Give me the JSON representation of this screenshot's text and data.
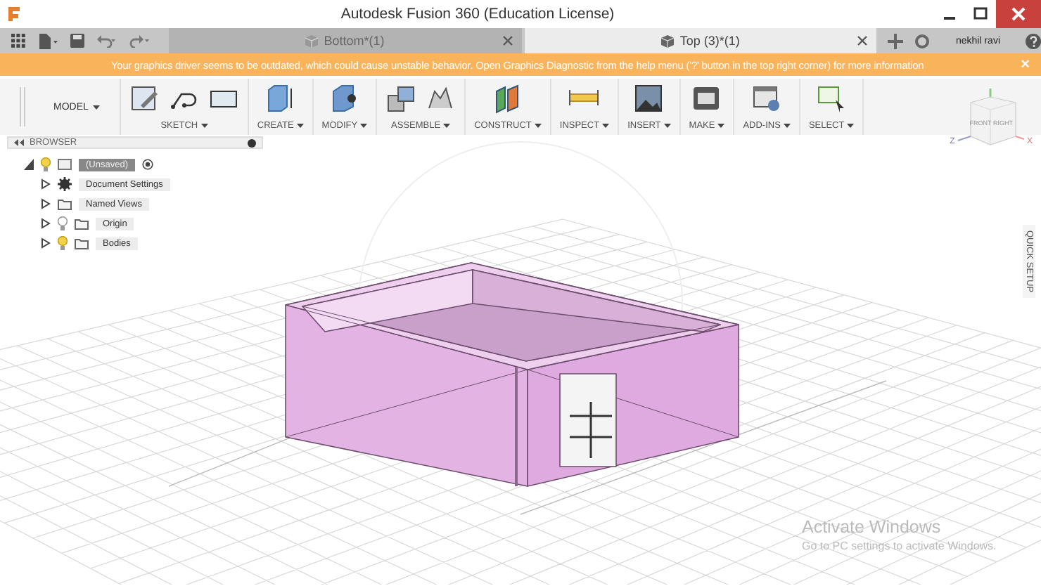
{
  "window": {
    "title": "Autodesk Fusion 360 (Education License)"
  },
  "tabs": [
    {
      "label": "Bottom*(1)",
      "selected": false
    },
    {
      "label": "Top (3)*(1)",
      "selected": true
    }
  ],
  "user": {
    "name": "nekhil ravi"
  },
  "banner": {
    "text": "Your graphics driver seems to be outdated, which could cause unstable behavior. Open Graphics Diagnostic from the help menu ('?' button in the top right corner) for more information",
    "close": "×"
  },
  "toolbar": {
    "workspace": "MODEL",
    "groups": [
      {
        "label": "SKETCH"
      },
      {
        "label": "CREATE"
      },
      {
        "label": "MODIFY"
      },
      {
        "label": "ASSEMBLE"
      },
      {
        "label": "CONSTRUCT"
      },
      {
        "label": "INSPECT"
      },
      {
        "label": "INSERT"
      },
      {
        "label": "MAKE"
      },
      {
        "label": "ADD-INS"
      },
      {
        "label": "SELECT"
      }
    ]
  },
  "browser": {
    "title": "BROWSER",
    "tree": [
      {
        "label": "(Unsaved)",
        "kind": "component",
        "visible": true,
        "expanded": true,
        "selected": true,
        "children": [
          {
            "label": "Document Settings",
            "kind": "settings",
            "expanded": false,
            "selected": false
          },
          {
            "label": "Named Views",
            "kind": "folder",
            "expanded": false,
            "selected": false
          },
          {
            "label": "Origin",
            "kind": "folder",
            "visible": false,
            "expanded": false,
            "selected": false
          },
          {
            "label": "Bodies",
            "kind": "folder",
            "visible": true,
            "expanded": false,
            "selected": false
          }
        ]
      }
    ]
  },
  "viewcube": {
    "front": "FRONT",
    "right": "RIGHT",
    "axis_z": "Z",
    "axis_x": "X"
  },
  "quick_setup": "QUICK SETUP",
  "activation": {
    "title": "Activate Windows",
    "subtitle": "Go to PC settings to activate Windows."
  }
}
